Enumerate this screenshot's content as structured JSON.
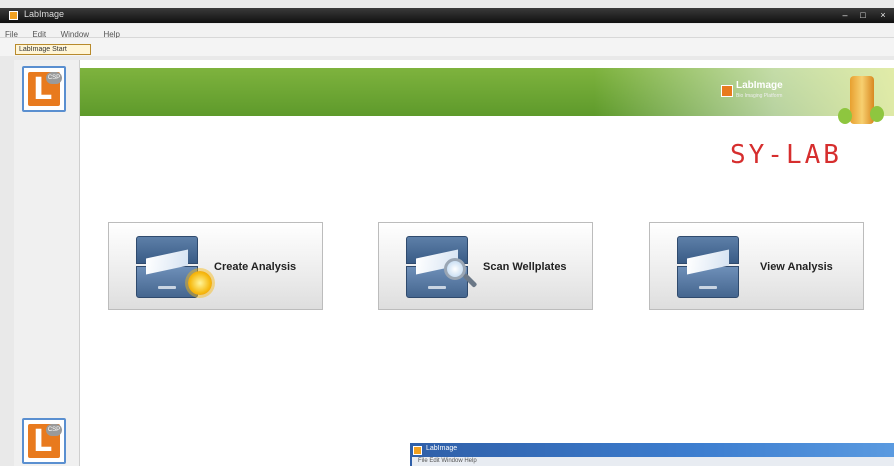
{
  "window": {
    "title": "LabImage"
  },
  "window_controls": {
    "minimize": "–",
    "maximize": "□",
    "close": "×"
  },
  "menu": [
    "File",
    "Edit",
    "Window",
    "Help"
  ],
  "tab": {
    "label": "LabImage Start"
  },
  "sidebar": {
    "logo_letter": "L",
    "logo_badge": "CSP"
  },
  "banner": {
    "brand": "LabImage",
    "brand_sub": "Bio Imaging Platform",
    "vendor": "SY-LAB"
  },
  "actions": [
    {
      "label": "Create Analysis",
      "icon": "cabinet-sun-icon"
    },
    {
      "label": "Scan Wellplates",
      "icon": "cabinet-magnifier-icon"
    },
    {
      "label": "View Analysis",
      "icon": "cabinet-icon"
    }
  ],
  "overlay_window": {
    "title": "LabImage",
    "menu": "File  Edit  Window  Help"
  },
  "colors": {
    "banner_green": "#6aa533",
    "vendor_red": "#d62e2e",
    "logo_orange": "#e87a1e"
  }
}
